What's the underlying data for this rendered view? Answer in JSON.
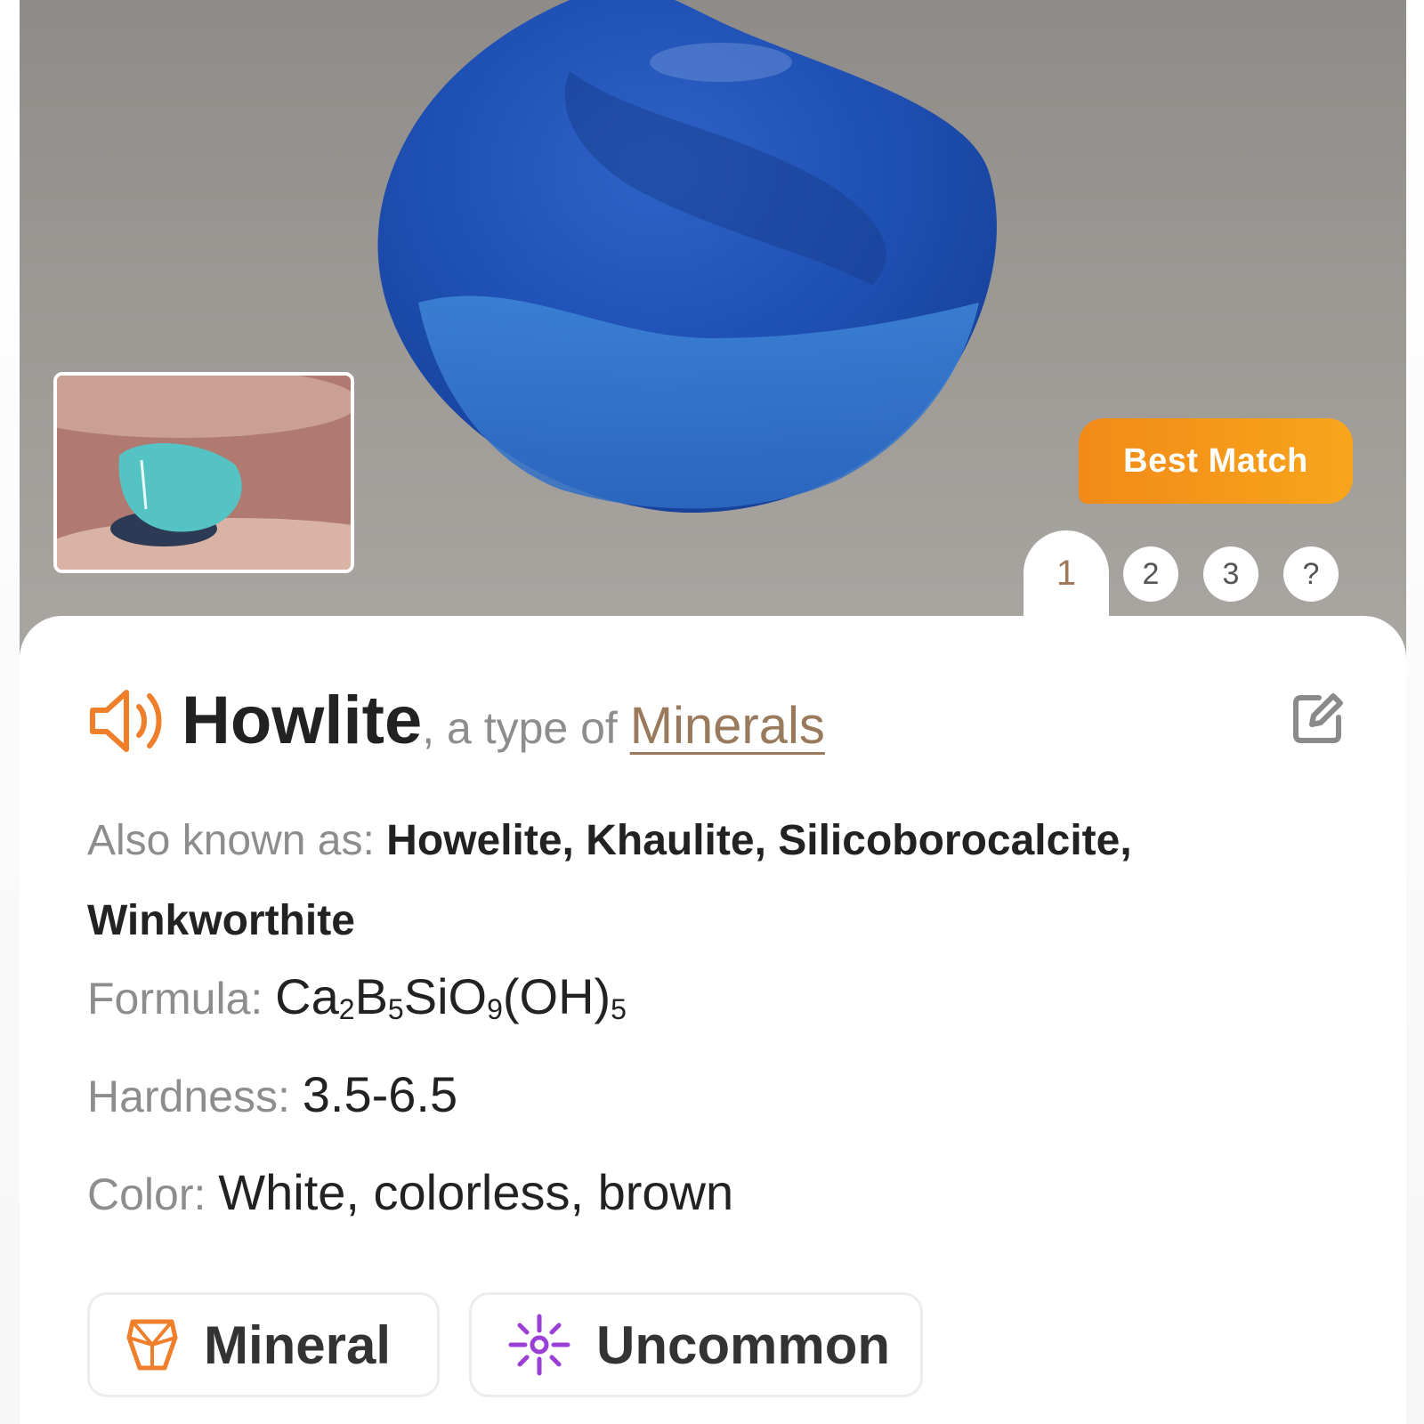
{
  "hero": {
    "badge_label": "Best Match",
    "tabs": [
      {
        "label": "1",
        "active": true
      },
      {
        "label": "2",
        "active": false
      },
      {
        "label": "3",
        "active": false
      },
      {
        "label": "?",
        "active": false
      }
    ]
  },
  "result": {
    "name": "Howlite",
    "type_prefix": ", a type of ",
    "type_link": "Minerals",
    "aka_label": "Also known as: ",
    "aka_value": "Howelite, Khaulite, Silicoborocalcite, Winkworthite",
    "formula_label": "Formula: ",
    "formula_parts": [
      "Ca",
      "2",
      "B",
      "5",
      "SiO",
      "9",
      "(OH)",
      "5"
    ],
    "hardness_label": "Hardness: ",
    "hardness_value": "3.5-6.5",
    "color_label": "Color: ",
    "color_value": "White, colorless, brown"
  },
  "tags": {
    "mineral_label": "Mineral",
    "uncommon_label": "Uncommon"
  },
  "colors": {
    "accent": "#f28a18",
    "link": "#9a7a5c",
    "uncommon": "#9b3fd6"
  }
}
